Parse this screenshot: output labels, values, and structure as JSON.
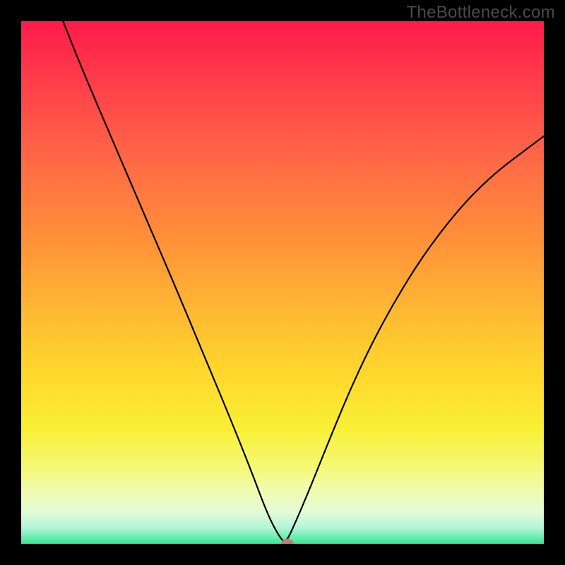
{
  "watermark": "TheBottleneck.com",
  "chart_data": {
    "type": "line",
    "title": "",
    "xlabel": "",
    "ylabel": "",
    "xlim": [
      0,
      100
    ],
    "ylim": [
      0,
      100
    ],
    "grid": false,
    "series": [
      {
        "name": "curve",
        "points": [
          {
            "x": 8,
            "y": 100
          },
          {
            "x": 12,
            "y": 90
          },
          {
            "x": 18,
            "y": 76
          },
          {
            "x": 24,
            "y": 62
          },
          {
            "x": 30,
            "y": 48
          },
          {
            "x": 35,
            "y": 36
          },
          {
            "x": 40,
            "y": 24
          },
          {
            "x": 44,
            "y": 14
          },
          {
            "x": 47,
            "y": 6
          },
          {
            "x": 49,
            "y": 2
          },
          {
            "x": 50.5,
            "y": 0
          },
          {
            "x": 52,
            "y": 3
          },
          {
            "x": 55,
            "y": 10
          },
          {
            "x": 59,
            "y": 20
          },
          {
            "x": 64,
            "y": 32
          },
          {
            "x": 70,
            "y": 44
          },
          {
            "x": 78,
            "y": 57
          },
          {
            "x": 88,
            "y": 69
          },
          {
            "x": 100,
            "y": 78
          }
        ]
      }
    ],
    "marker": {
      "x": 51,
      "y": 0,
      "color": "#c77b6c"
    }
  }
}
